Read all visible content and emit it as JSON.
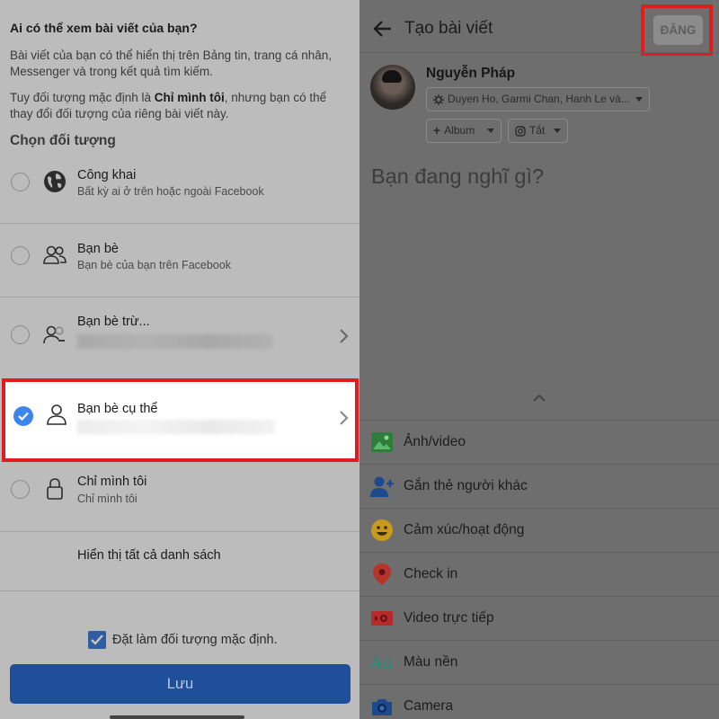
{
  "left_panel": {
    "question": "Ai có thể xem bài viết của bạn?",
    "desc1": "Bài viết của bạn có thể hiển thị trên Bảng tin, trang cá nhân, Messenger và trong kết quả tìm kiếm.",
    "desc2_pre": "Tuy đối tượng mặc định là ",
    "desc2_bold": "Chỉ mình tôi",
    "desc2_post": ", nhưng bạn có thể thay đổi đối tượng của riêng bài viết này.",
    "section_title": "Chọn đối tượng",
    "options": [
      {
        "title": "Công khai",
        "subtitle": "Bất kỳ ai ở trên hoặc ngoài Facebook",
        "icon": "globe-icon"
      },
      {
        "title": "Bạn bè",
        "subtitle": "Bạn bè của bạn trên Facebook",
        "icon": "friends-icon"
      },
      {
        "title": "Bạn bè trừ...",
        "subtitle": "",
        "icon": "friends-except-icon"
      },
      {
        "title": "Bạn bè cụ thể",
        "subtitle": "",
        "icon": "person-icon",
        "selected": true
      },
      {
        "title": "Chỉ mình tôi",
        "subtitle": "Chỉ mình tôi",
        "icon": "lock-icon"
      }
    ],
    "show_all": "Hiển thị tất cả danh sách",
    "default_checkbox": "Đặt làm đối tượng mặc định.",
    "save_button": "Lưu"
  },
  "right_panel": {
    "title": "Tạo bài viết",
    "post_button": "ĐĂNG",
    "user_name": "Nguyễn Pháp",
    "audience_pill": "Duyen Ho, Garmi Chan, Hanh Le và...",
    "album_pill": "Album",
    "instagram_pill": "Tắt",
    "placeholder": "Bạn đang nghĩ gì?",
    "actions": [
      {
        "label": "Ảnh/video",
        "icon": "photo-icon",
        "color": "#2e7d3a"
      },
      {
        "label": "Gắn thẻ người khác",
        "icon": "tag-people-icon",
        "color": "#1c4a8c"
      },
      {
        "label": "Cảm xúc/hoạt động",
        "icon": "emoji-icon",
        "color": "#c79a1e"
      },
      {
        "label": "Check in",
        "icon": "location-pin-icon",
        "color": "#b8342b"
      },
      {
        "label": "Video trực tiếp",
        "icon": "live-video-icon",
        "color": "#b82b2b"
      },
      {
        "label": "Màu nền",
        "icon": "background-color-icon",
        "color": "#2a8a7a"
      },
      {
        "label": "Camera",
        "icon": "camera-icon",
        "color": "#1c4a8c"
      }
    ]
  },
  "colors": {
    "highlight_border": "#e01d1d",
    "checked_radio": "#3c85ec",
    "save_button": "#1f4f9a"
  }
}
